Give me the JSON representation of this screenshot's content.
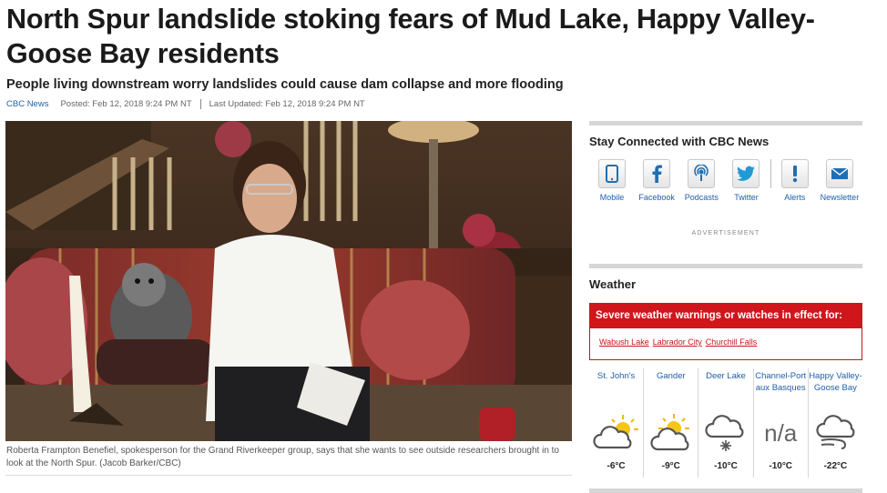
{
  "article": {
    "headline": "North Spur landslide stoking fears of Mud Lake, Happy Valley-Goose Bay residents",
    "deck": "People living downstream worry landslides could cause dam collapse and more flooding",
    "source": "CBC News",
    "posted": "Posted: Feb 12, 2018 9:24 PM NT",
    "updated": "Last Updated: Feb 12, 2018 9:24 PM NT",
    "caption": "Roberta Frampton Benefiel, spokesperson for the Grand Riverkeeper group, says that she wants to see outside researchers brought in to look at the North Spur. (Jacob Barker/CBC)"
  },
  "sidebar": {
    "social_title": "Stay Connected with CBC News",
    "social": [
      {
        "label": "Mobile",
        "icon": "mobile-icon"
      },
      {
        "label": "Facebook",
        "icon": "facebook-icon"
      },
      {
        "label": "Podcasts",
        "icon": "podcast-icon"
      },
      {
        "label": "Twitter",
        "icon": "twitter-icon"
      },
      {
        "label": "Alerts",
        "icon": "alert-icon"
      },
      {
        "label": "Newsletter",
        "icon": "envelope-icon"
      }
    ],
    "advertisement": "ADVERTISEMENT",
    "weather_title": "Weather",
    "warning_heading": "Severe weather warnings or watches in effect for:",
    "warning_links": [
      "Wabush Lake",
      "Labrador City",
      "Churchill Falls"
    ],
    "forecast": [
      {
        "city": "St. John's",
        "temp": "-6°C",
        "icon": "partly-cloudy-icon"
      },
      {
        "city": "Gander",
        "temp": "-9°C",
        "icon": "partly-cloudy-icon"
      },
      {
        "city": "Deer Lake",
        "temp": "-10°C",
        "icon": "cloud-snow-icon"
      },
      {
        "city": "Channel-Port aux Basques",
        "temp": "-10°C",
        "icon": "not-available-icon",
        "icon_text": "n/a"
      },
      {
        "city": "Happy Valley-Goose Bay",
        "temp": "-22°C",
        "icon": "cloud-wind-icon"
      }
    ],
    "colors": {
      "accent": "#1f5fa8",
      "warning": "#d0161b",
      "rule": "#d6d6d6"
    }
  }
}
